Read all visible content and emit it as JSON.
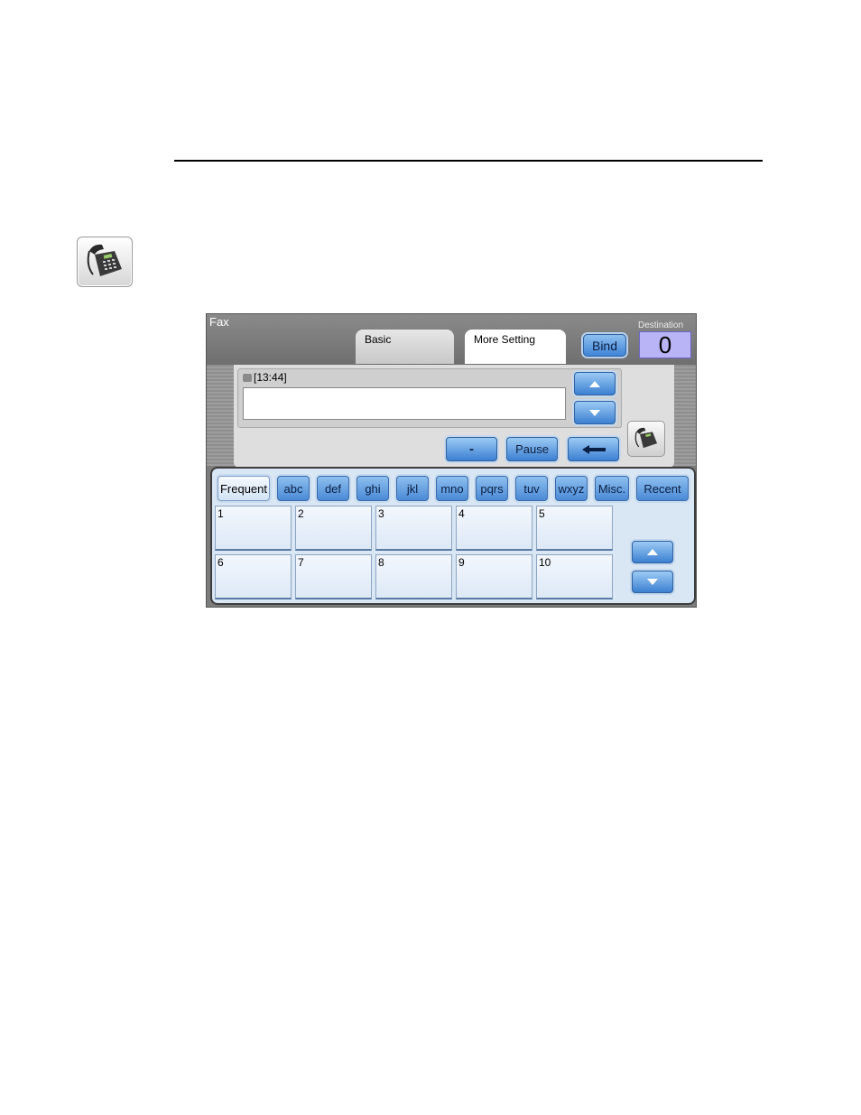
{
  "panel": {
    "title": "Fax",
    "tabs": [
      "Basic",
      "More Setting"
    ],
    "bind_label": "Bind",
    "destination_label": "Destination",
    "destination_count": "0",
    "entry_time": "[13:44]",
    "entry_value": "",
    "keys": {
      "dash": "-",
      "pause": "Pause"
    },
    "letter_tabs": [
      "Frequent",
      "abc",
      "def",
      "ghi",
      "jkl",
      "mno",
      "pqrs",
      "tuv",
      "wxyz",
      "Misc.",
      "Recent"
    ],
    "active_letter_tab": "Frequent",
    "slots": [
      "1",
      "2",
      "3",
      "4",
      "5",
      "6",
      "7",
      "8",
      "9",
      "10"
    ]
  },
  "colors": {
    "button_blue": "#3f84d6",
    "destination_bg": "#b8b4f6",
    "directory_bg": "#d9e6f4"
  }
}
